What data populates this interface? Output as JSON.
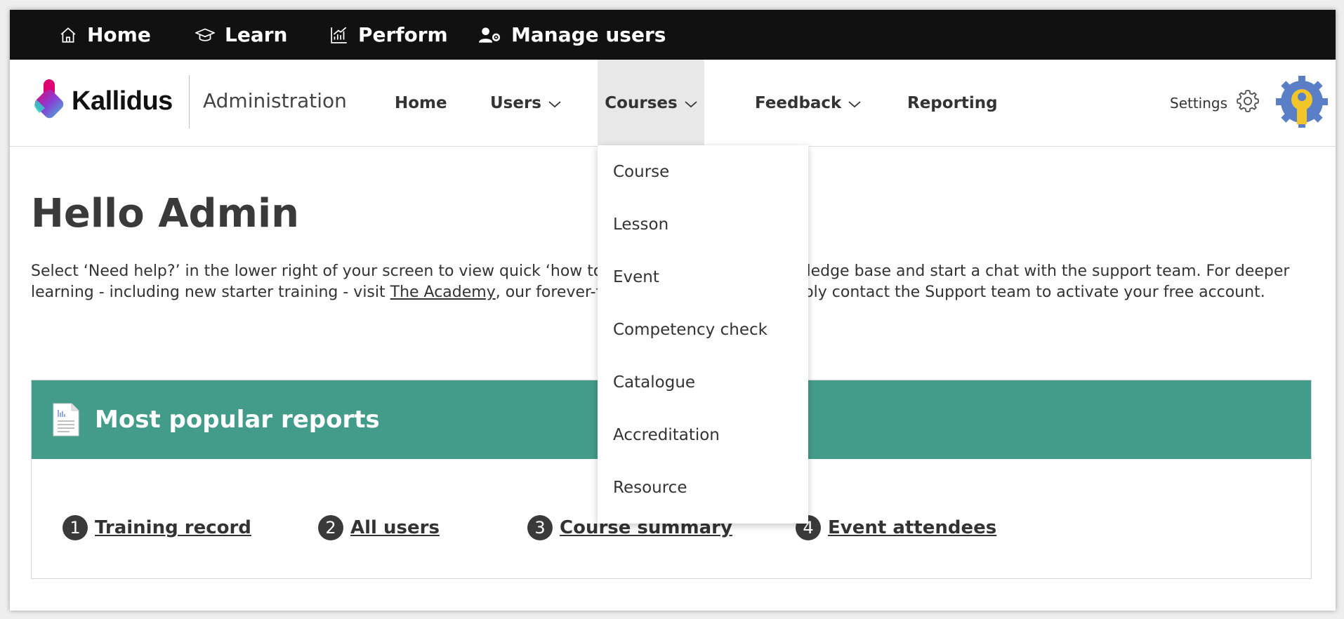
{
  "topbar": {
    "items": [
      {
        "label": "Home",
        "icon": "home-icon"
      },
      {
        "label": "Learn",
        "icon": "graduation-cap-icon"
      },
      {
        "label": "Perform",
        "icon": "performance-chart-icon"
      },
      {
        "label": "Manage users",
        "icon": "user-settings-icon"
      }
    ]
  },
  "brand": {
    "name": "Kallidus",
    "section": "Administration"
  },
  "nav": {
    "items": [
      {
        "label": "Home"
      },
      {
        "label": "Users"
      },
      {
        "label": "Courses"
      },
      {
        "label": "Feedback"
      },
      {
        "label": "Reporting"
      }
    ],
    "settings_label": "Settings"
  },
  "courses_menu": {
    "items": [
      "Course",
      "Lesson",
      "Event",
      "Competency check",
      "Catalogue",
      "Accreditation",
      "Resource"
    ]
  },
  "main": {
    "greeting": "Hello Admin",
    "intro_before_link": "Select ‘Need help?’ in the lower right of your screen to view quick ‘how to’ articles, search our knowledge base and start a chat with the support team. For deeper learning - including new starter training - visit ",
    "intro_link": "The Academy",
    "intro_after_link": ", our forever-free learning platform. Simply contact the Support team to activate your free account."
  },
  "reports": {
    "title": "Most popular reports",
    "items": [
      {
        "number": "1",
        "label": "Training record"
      },
      {
        "number": "2",
        "label": "All users"
      },
      {
        "number": "3",
        "label": "Course summary"
      },
      {
        "number": "4",
        "label": "Event attendees"
      }
    ]
  },
  "colors": {
    "topbar": "#111111",
    "reports_header": "#439c8a",
    "active_nav": "#e8e8e8",
    "avatar_blue": "#5b7fc7",
    "avatar_yellow": "#f2c52b"
  }
}
